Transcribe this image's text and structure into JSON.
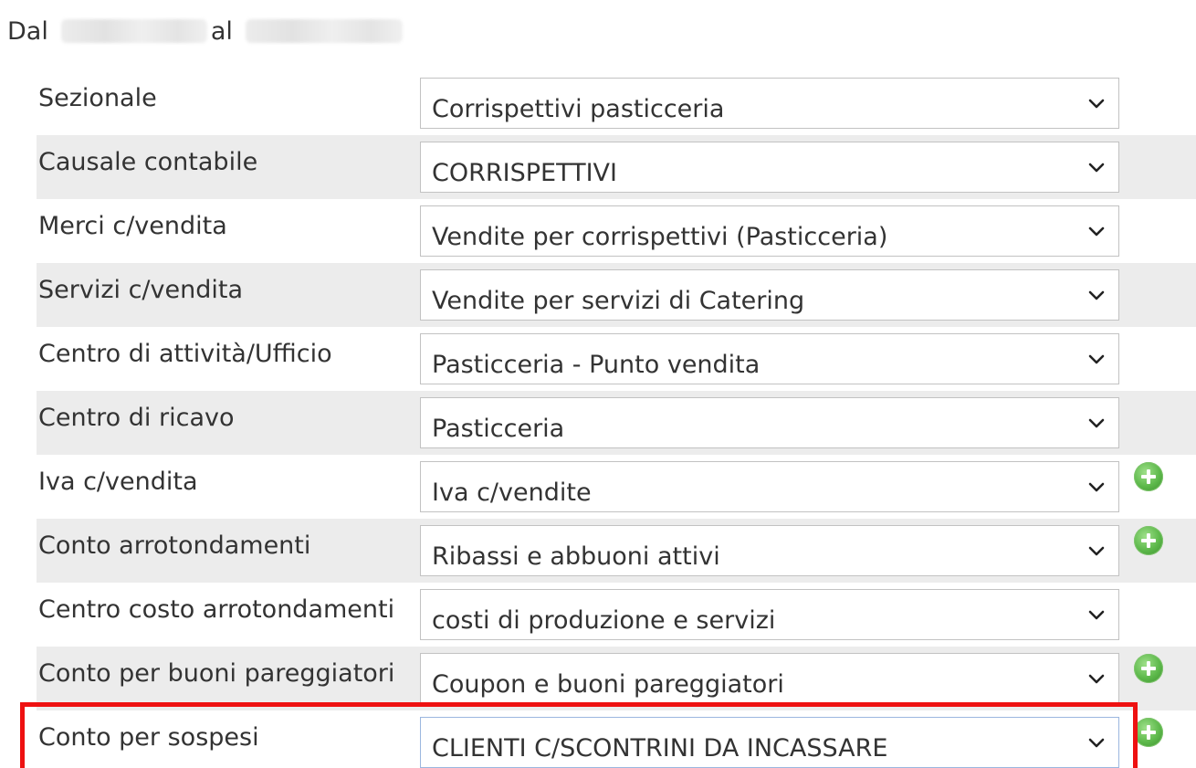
{
  "header": {
    "from_label": "Dal",
    "to_label": "al"
  },
  "rows": [
    {
      "label": "Sezionale",
      "value": "Corrispettivi pasticceria",
      "has_add": false
    },
    {
      "label": "Causale contabile",
      "value": "CORRISPETTIVI",
      "has_add": false
    },
    {
      "label": "Merci c/vendita",
      "value": "Vendite per corrispettivi (Pasticceria)",
      "has_add": false
    },
    {
      "label": "Servizi c/vendita",
      "value": "Vendite per servizi di Catering",
      "has_add": false
    },
    {
      "label": "Centro di attività/Ufficio",
      "value": "Pasticceria - Punto vendita",
      "has_add": false
    },
    {
      "label": "Centro di ricavo",
      "value": "Pasticceria",
      "has_add": false
    },
    {
      "label": "Iva c/vendita",
      "value": "Iva c/vendite",
      "has_add": true
    },
    {
      "label": "Conto arrotondamenti",
      "value": "Ribassi e abbuoni attivi",
      "has_add": true
    },
    {
      "label": "Centro costo arrotondamenti",
      "value": "costi di produzione e servizi",
      "has_add": false
    },
    {
      "label": "Conto per buoni pareggiatori",
      "value": "Coupon e buoni pareggiatori",
      "has_add": true
    },
    {
      "label": "Conto per sospesi",
      "value": "CLIENTI C/SCONTRINI DA INCASSARE",
      "has_add": true
    }
  ],
  "colors": {
    "stripe": "#ececec",
    "highlight": "#ee1111",
    "add_button": "#5cb84a"
  },
  "icons": {
    "dropdown": "chevron-down-icon",
    "add": "plus-circle-icon"
  }
}
